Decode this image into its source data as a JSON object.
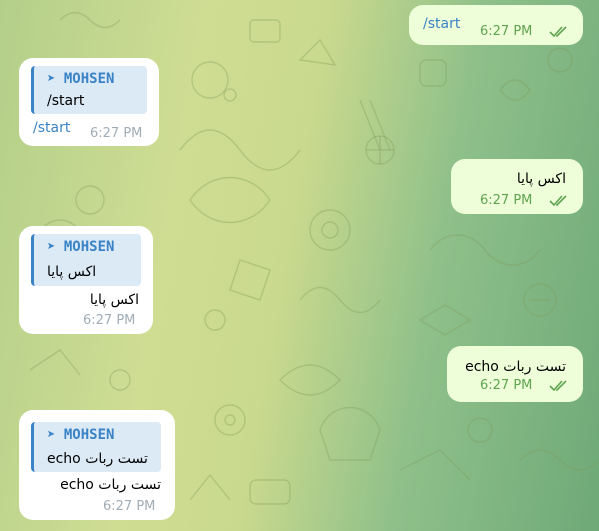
{
  "colors": {
    "outgoing_bubble": "#eefed8",
    "incoming_bubble": "#ffffff",
    "link": "#3a83c6",
    "quote_bg": "#dceaf6",
    "time_out": "#5fa451",
    "time_in": "#a0acb6"
  },
  "messages": [
    {
      "direction": "outgoing",
      "text": "/start",
      "time": "6:27 PM",
      "status": "read-double-check-icon"
    },
    {
      "direction": "incoming",
      "quote_author": "➤ MOHSEN",
      "quote_text": "/start",
      "text": "/start",
      "time": "6:27 PM"
    },
    {
      "direction": "outgoing",
      "text": "اکس پایا",
      "time": "6:27 PM",
      "status": "read-double-check-icon"
    },
    {
      "direction": "incoming",
      "quote_author": "➤ MOHSEN",
      "quote_text": "اکس پایا",
      "text": "اکس پایا",
      "time": "6:27 PM"
    },
    {
      "direction": "outgoing",
      "text": "تست ربات echo",
      "time": "6:27 PM",
      "status": "read-double-check-icon"
    },
    {
      "direction": "incoming",
      "quote_author": "➤ MOHSEN",
      "quote_text": "تست ربات echo",
      "text": "تست ربات echo",
      "time": "6:27 PM"
    }
  ]
}
